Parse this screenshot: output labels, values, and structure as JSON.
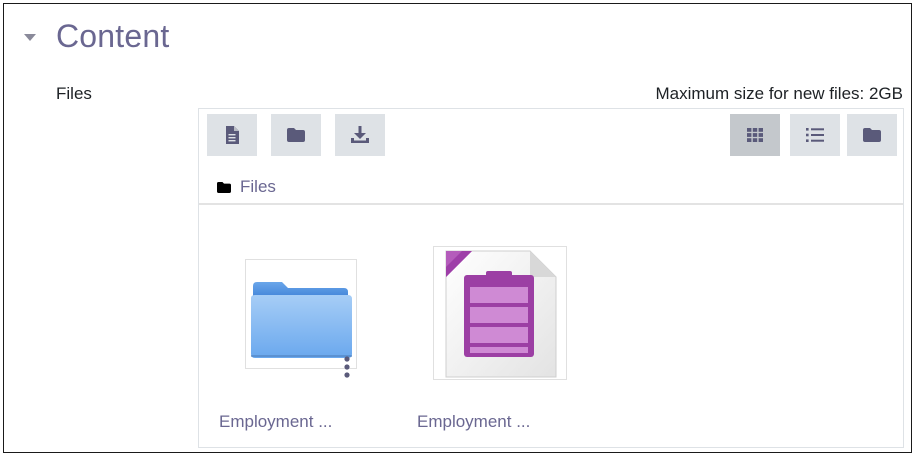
{
  "section": {
    "title": "Content"
  },
  "files_field": {
    "label": "Files",
    "max_size_text": "Maximum size for new files: 2GB"
  },
  "toolbar": {
    "left_buttons": [
      {
        "icon": "add-file-icon"
      },
      {
        "icon": "create-folder-icon"
      },
      {
        "icon": "download-icon"
      }
    ],
    "view_buttons": [
      {
        "icon": "grid-view-icon",
        "active": true
      },
      {
        "icon": "list-view-icon",
        "active": false
      },
      {
        "icon": "tree-view-icon",
        "active": false
      }
    ],
    "path_label": "Files"
  },
  "files": [
    {
      "name": "Employment ...",
      "type": "folder",
      "icon": "folder-icon"
    },
    {
      "name": "Employment ...",
      "type": "database",
      "icon": "database-file-icon"
    }
  ],
  "colors": {
    "link": "#6a6791",
    "button_bg": "#dee2e6",
    "button_active_bg": "#c4c8cc",
    "icon": "#5a5a7a"
  }
}
